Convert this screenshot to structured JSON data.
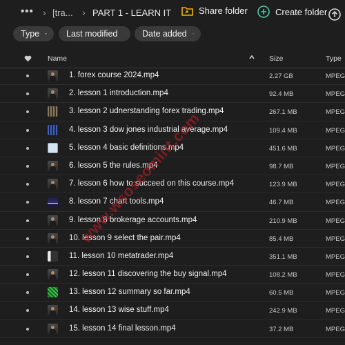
{
  "breadcrumb": {
    "more": "•••",
    "parent": "[tra...",
    "current": "PART 1 - LEARN IT"
  },
  "toolbar": {
    "share_folder": "Share folder",
    "create_folder": "Create folder"
  },
  "filters": [
    {
      "label": "Type"
    },
    {
      "label": "Last modified"
    },
    {
      "label": "Date added"
    }
  ],
  "columns": {
    "name": "Name",
    "size": "Size",
    "type": "Type"
  },
  "files": [
    {
      "name": "1. forex course 2024.mp4",
      "size": "2.27 GB",
      "type": "MPEG",
      "thumb": "person"
    },
    {
      "name": "2. lesson 1 introduction.mp4",
      "size": "92.4 MB",
      "type": "MPEG",
      "thumb": "person"
    },
    {
      "name": "3. lesson 2 udnerstanding forex trading.mp4",
      "size": "267.1 MB",
      "type": "MPEG",
      "thumb": "bars"
    },
    {
      "name": "4. lesson 3 dow jones industrial average.mp4",
      "size": "109.4 MB",
      "type": "MPEG",
      "thumb": "blue"
    },
    {
      "name": "5. lesson 4 basic definitions.mp4",
      "size": "451.6 MB",
      "type": "MPEG",
      "thumb": "screen"
    },
    {
      "name": "6. lesson 5 the rules.mp4",
      "size": "98.7 MB",
      "type": "MPEG",
      "thumb": "person"
    },
    {
      "name": "7. lesson 6 how to succeed on this course.mp4",
      "size": "123.9 MB",
      "type": "MPEG",
      "thumb": "person"
    },
    {
      "name": "8. lesson 7 chart tools.mp4",
      "size": "46.7 MB",
      "type": "MPEG",
      "thumb": "chart"
    },
    {
      "name": "9. lesson 8 brokerage accounts.mp4",
      "size": "210.9 MB",
      "type": "MPEG",
      "thumb": "person"
    },
    {
      "name": "10. lesson 9 select the pair.mp4",
      "size": "85.4 MB",
      "type": "MPEG",
      "thumb": "person"
    },
    {
      "name": "11. lesson 10 metatrader.mp4",
      "size": "351.1 MB",
      "type": "MPEG",
      "thumb": "split"
    },
    {
      "name": "12. lesson 11 discovering the buy signal.mp4",
      "size": "108.2 MB",
      "type": "MPEG",
      "thumb": "person"
    },
    {
      "name": "13. lesson 12 summary so far.mp4",
      "size": "60.5 MB",
      "type": "MPEG",
      "thumb": "green"
    },
    {
      "name": "14. lesson 13 wise stuff.mp4",
      "size": "242.9 MB",
      "type": "MPEG",
      "thumb": "person"
    },
    {
      "name": "15. lesson 14 final lesson.mp4",
      "size": "37.2 MB",
      "type": "MPEG",
      "thumb": "person"
    }
  ],
  "watermark": "www.wsoseomint.com",
  "colors": {
    "background": "#1e1e1e",
    "chip": "#3a3a3a",
    "folder_icon": "#f0b400",
    "create_icon": "#4fc9a4",
    "watermark": "#c81e28"
  }
}
